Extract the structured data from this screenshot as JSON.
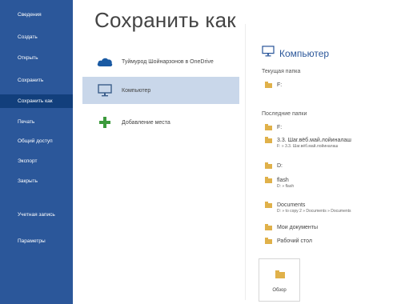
{
  "sidebar": {
    "items": [
      {
        "label": "Сведения"
      },
      {
        "label": "Создать"
      },
      {
        "label": "Открыть"
      },
      {
        "label": "Сохранить"
      },
      {
        "label": "Сохранить как",
        "active": true
      },
      {
        "label": "Печать"
      },
      {
        "label": "Общий доступ"
      },
      {
        "label": "Экспорт"
      },
      {
        "label": "Закрыть"
      },
      {
        "label": "Учетная запись"
      },
      {
        "label": "Параметры"
      }
    ]
  },
  "main": {
    "title": "Сохранить как",
    "locations": [
      {
        "label": "Туймурод Шойнарзонов в OneDrive",
        "icon": "cloud-icon"
      },
      {
        "label": "Компьютер",
        "icon": "computer-icon",
        "active": true
      },
      {
        "label": "Добавление места",
        "icon": "plus-icon"
      }
    ]
  },
  "right": {
    "header": "Компьютер",
    "current_folder_label": "Текущая папка",
    "current_folder": {
      "name": "F:"
    },
    "recent_folders_label": "Последние папки",
    "recent_folders": [
      {
        "name": "F:",
        "path": ""
      },
      {
        "name": "3.3. Шаг.вёб.май.лойиналаш",
        "path": "F: » 3.3. Шаг.вёб.май.лойиналаш"
      },
      {
        "name": "D:",
        "path": ""
      },
      {
        "name": "flash",
        "path": "D: » flash"
      },
      {
        "name": "Documents",
        "path": "D: » to copy 2 » Documents » Documents"
      },
      {
        "name": "Мои документы",
        "path": ""
      },
      {
        "name": "Рабочий стол",
        "path": ""
      }
    ],
    "browse_label": "Обзор"
  },
  "colors": {
    "sidebar": "#2b579a",
    "sidebar_active": "#123f7c",
    "selection": "#c9d7ea",
    "folder": "#e0b14a"
  }
}
